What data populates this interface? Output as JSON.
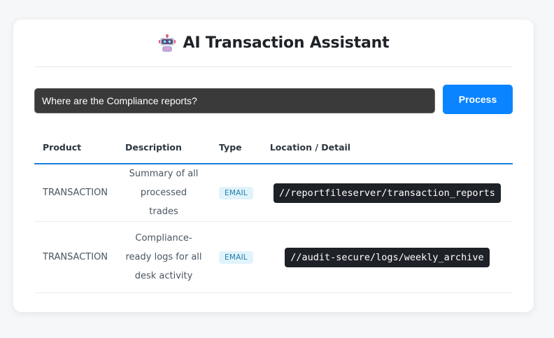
{
  "header": {
    "title": "AI Transaction Assistant",
    "icon": "robot-icon"
  },
  "query": {
    "value": "Where are the Compliance reports?",
    "button_label": "Process"
  },
  "table": {
    "columns": [
      "Product",
      "Description",
      "Type",
      "Location / Detail"
    ],
    "rows": [
      {
        "product": "TRANSACTION",
        "description": "Summary of all processed trades",
        "type": "EMAIL",
        "location": "//reportfileserver/transaction_reports"
      },
      {
        "product": "TRANSACTION",
        "description": "Compliance-ready logs for all desk activity",
        "type": "EMAIL",
        "location": "//audit-secure/logs/weekly_archive"
      }
    ]
  },
  "colors": {
    "accent": "#0a84ff",
    "header_rule": "#1a7fd9",
    "badge_bg": "#e1f3fb",
    "badge_text": "#1f7da8",
    "code_bg": "#1e2127"
  }
}
